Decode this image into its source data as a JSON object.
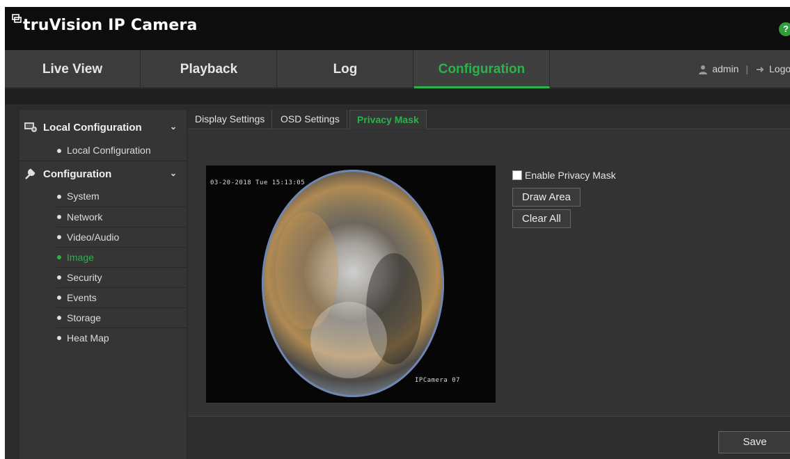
{
  "app": {
    "title": "truVision IP Camera",
    "help_label": "?"
  },
  "nav": {
    "tabs": [
      "Live View",
      "Playback",
      "Log",
      "Configuration"
    ],
    "active_tab": "Configuration",
    "user": "admin",
    "separator": "|",
    "logout_label": "Logout"
  },
  "sidebar": {
    "local_group": {
      "label": "Local Configuration",
      "items": [
        "Local Configuration"
      ]
    },
    "config_group": {
      "label": "Configuration",
      "items": [
        "System",
        "Network",
        "Video/Audio",
        "Image",
        "Security",
        "Events",
        "Storage",
        "Heat Map"
      ],
      "active_item": "Image"
    }
  },
  "sub_tabs": {
    "items": [
      "Display Settings",
      "OSD Settings",
      "Privacy Mask"
    ],
    "active": "Privacy Mask"
  },
  "video": {
    "timestamp": "03-20-2018 Tue 15:13:05",
    "camera_name": "IPCamera 07"
  },
  "privacy": {
    "enable_label": "Enable Privacy Mask",
    "enabled": false,
    "draw_area_label": "Draw Area",
    "clear_all_label": "Clear All"
  },
  "footer": {
    "save_label": "Save"
  },
  "colors": {
    "accent": "#2bb34b",
    "header_bg": "#0d0d0d",
    "nav_bg": "#3c3c3c",
    "help_bg": "#2f9e3a"
  }
}
